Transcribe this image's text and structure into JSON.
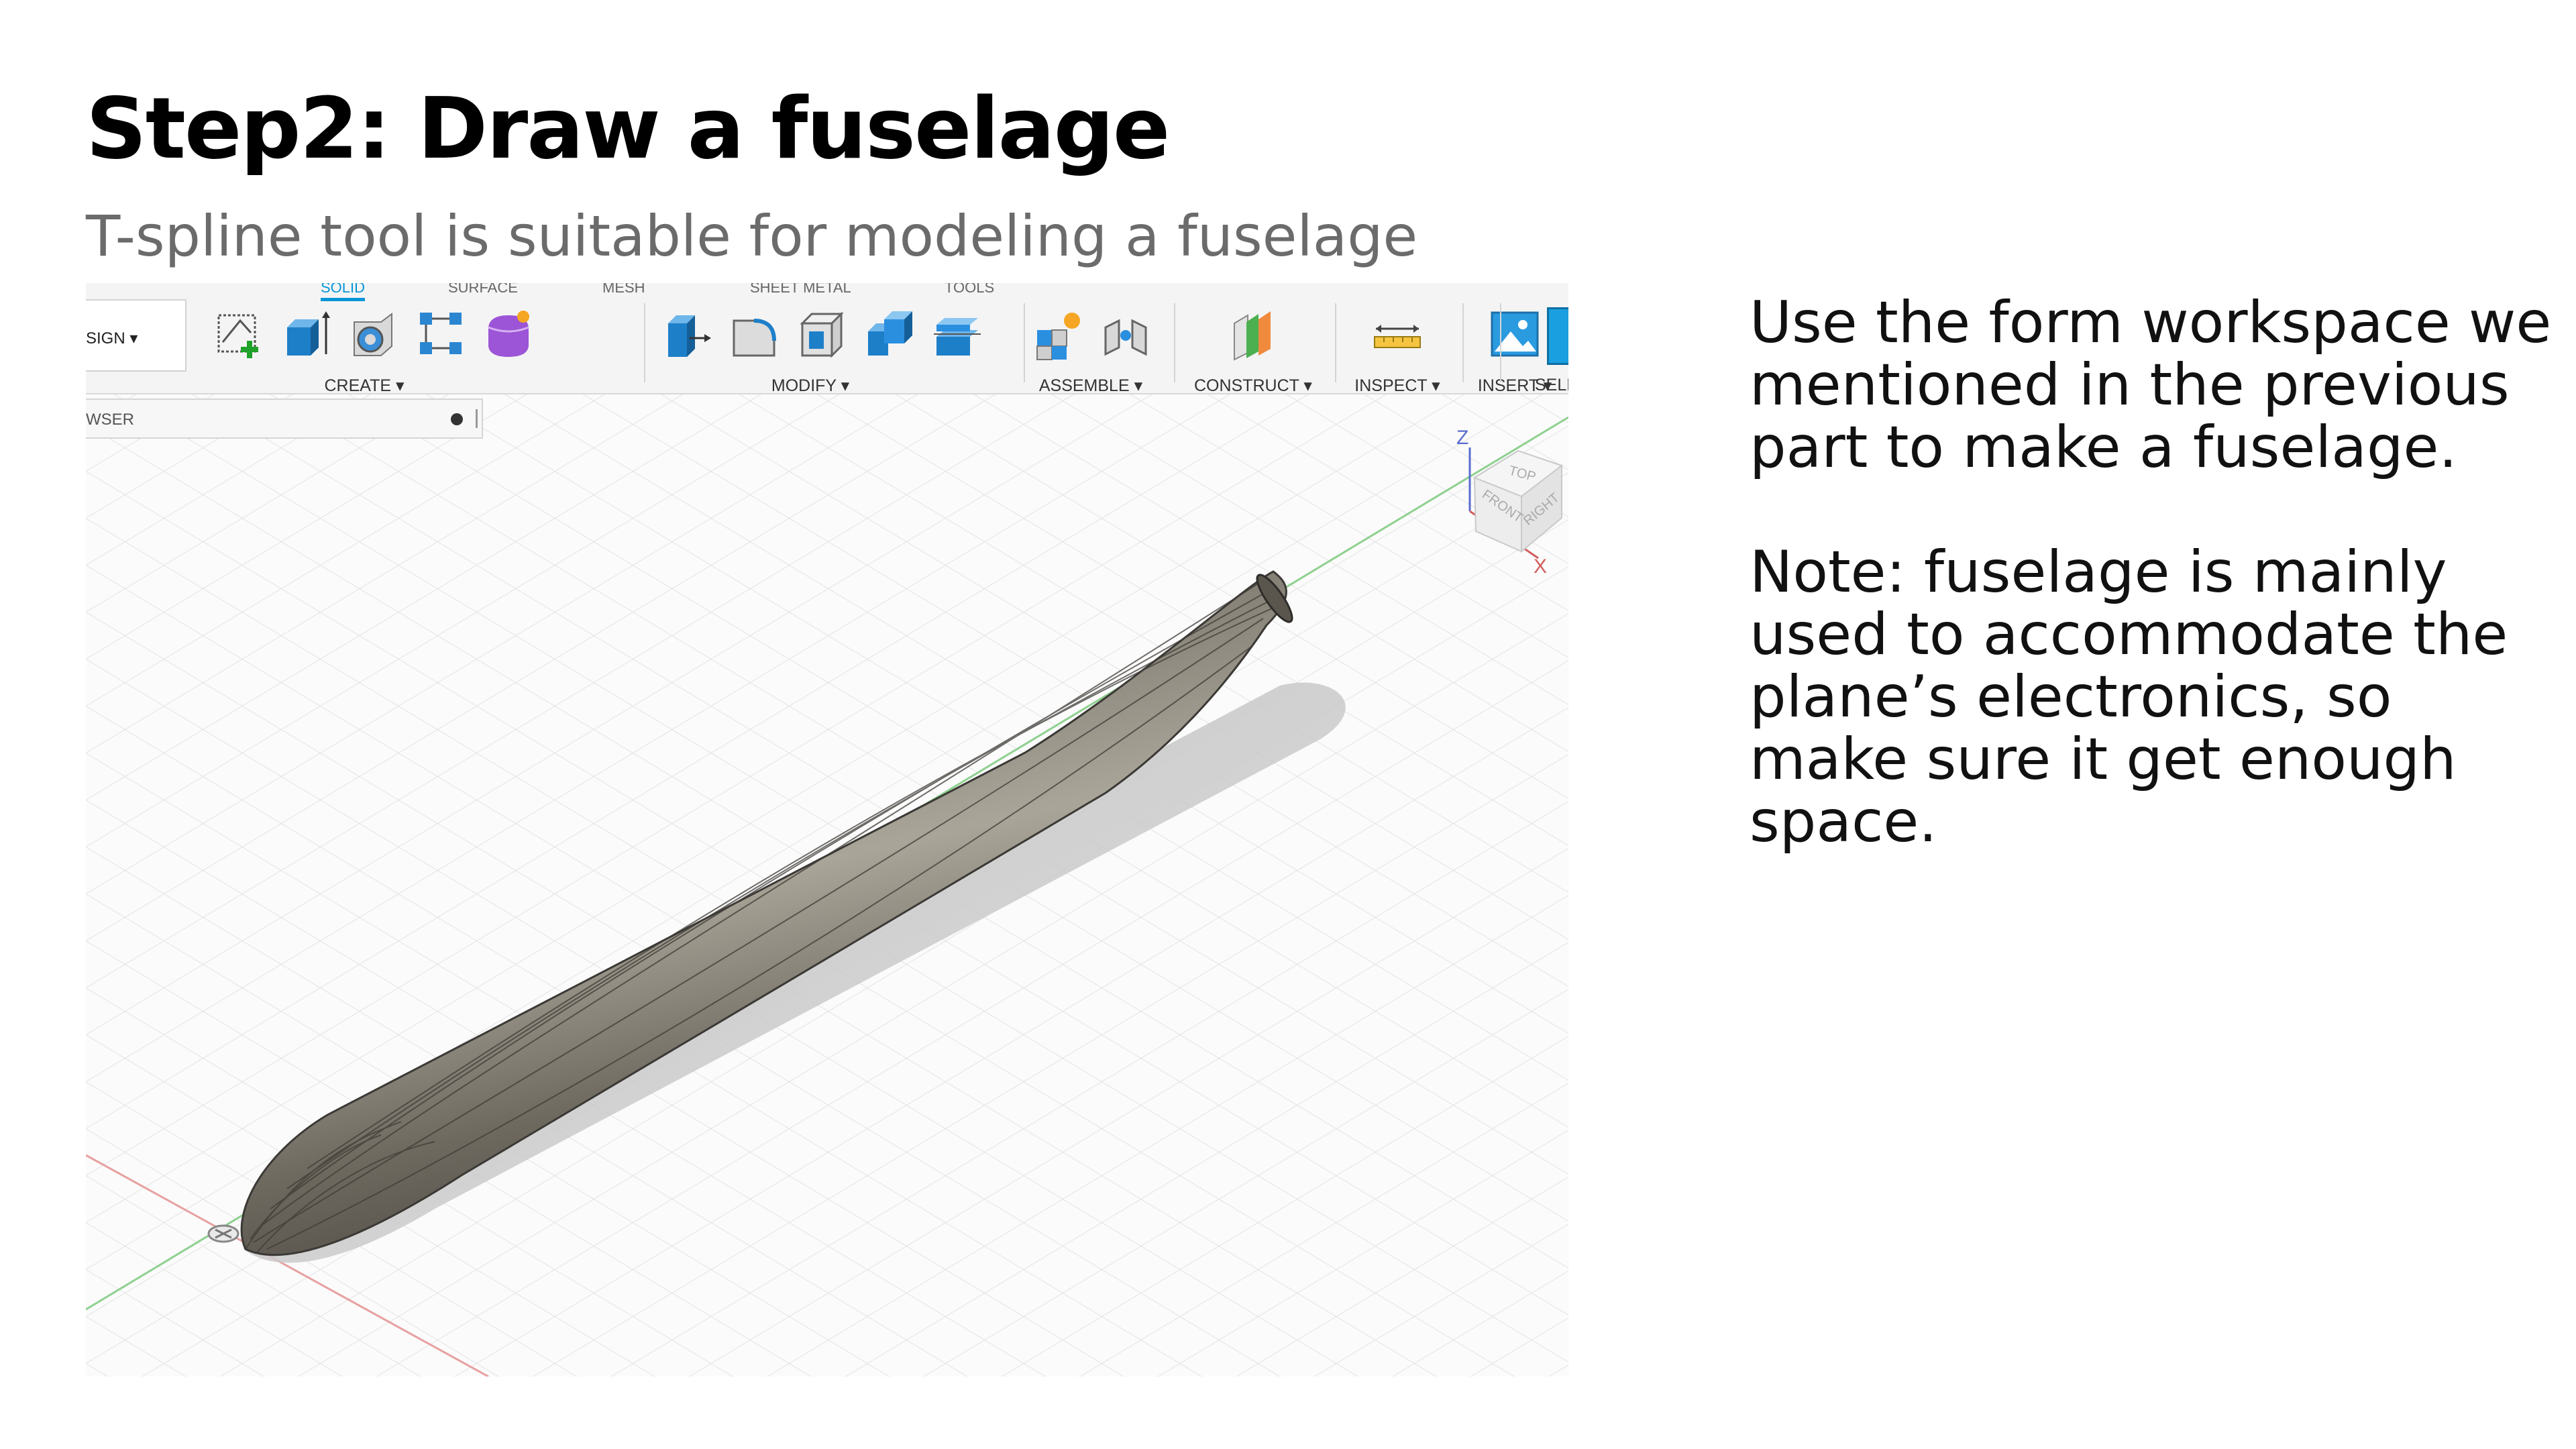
{
  "slide": {
    "title": "Step2: Draw a fuselage",
    "subtitle": "T-spline tool is suitable for modeling a fuselage",
    "body_paragraphs": [
      "Use the form workspace we mentioned in the previous part to make a fuselage.",
      "Note: fuselage is mainly used to accommodate the plane’s electronics, so make sure it get enough space."
    ]
  },
  "app": {
    "workspace_label": "SIGN ▾",
    "tabs": [
      "SOLID",
      "SURFACE",
      "MESH",
      "SHEET METAL",
      "TOOLS"
    ],
    "active_tab": "SOLID",
    "groups": {
      "create": "CREATE ▾",
      "modify": "MODIFY ▾",
      "assemble": "ASSEMBLE ▾",
      "construct": "CONSTRUCT ▾",
      "inspect": "INSPECT ▾",
      "insert": "INSERT ▾",
      "select": "SELEC"
    },
    "browser_label": "WSER",
    "viewcube": {
      "top": "TOP",
      "front": "FRONT",
      "right": "RIGHT",
      "axis_z": "Z",
      "axis_x": "X"
    },
    "colors": {
      "accent": "#0696d7",
      "fuselage": "#7b766b",
      "shadow": "#c9c9c9",
      "grid": "#e4e4e4",
      "axis_x": "#e8a0a0",
      "axis_y": "#8fd08f"
    }
  }
}
